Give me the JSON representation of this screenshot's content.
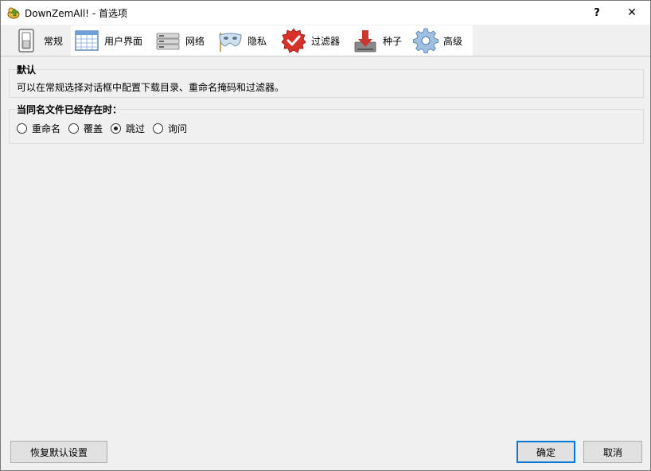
{
  "window": {
    "title": "DownZemAll! - 首选项",
    "help_label": "?",
    "close_label": "✕"
  },
  "tabs": [
    {
      "label": "常规",
      "icon": "switch-icon",
      "active": true
    },
    {
      "label": "用户界面",
      "icon": "window-grid-icon"
    },
    {
      "label": "网络",
      "icon": "server-icon"
    },
    {
      "label": "隐私",
      "icon": "mask-icon"
    },
    {
      "label": "过滤器",
      "icon": "check-badge-icon"
    },
    {
      "label": "种子",
      "icon": "download-torrent-icon"
    },
    {
      "label": "高级",
      "icon": "gear-icon"
    }
  ],
  "default_group": {
    "title": "默认",
    "description": "可以在常规选择对话框中配置下载目录、重命名掩码和过滤器。"
  },
  "exists_group": {
    "title": "当同名文件已经存在时：",
    "options": [
      {
        "label": "重命名",
        "checked": false
      },
      {
        "label": "覆盖",
        "checked": false
      },
      {
        "label": "跳过",
        "checked": true
      },
      {
        "label": "询问",
        "checked": false
      }
    ]
  },
  "buttons": {
    "restore_defaults": "恢复默认设置",
    "ok": "确定",
    "cancel": "取消"
  },
  "colors": {
    "accent": "#0078d7",
    "window_bg": "#f0f0f0"
  }
}
